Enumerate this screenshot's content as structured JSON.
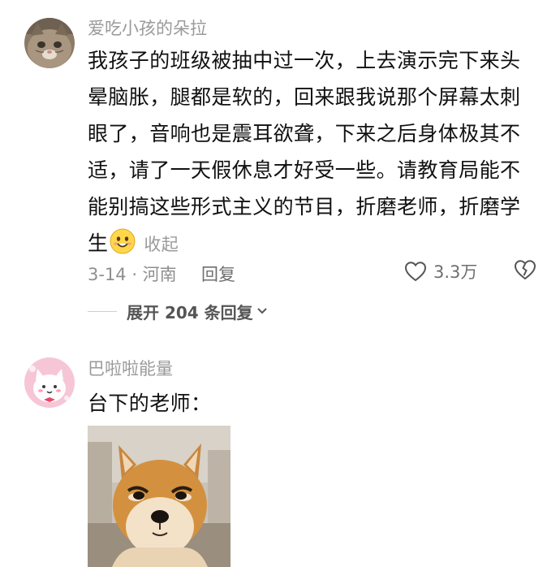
{
  "comments": [
    {
      "username": "爱吃小孩的朵拉",
      "avatar_icon": "cat-face-avatar",
      "text_lines": [
        "我孩子的班级被抽中过一次，上去演示完下来头",
        "晕脑胀，腿都是软的，回来跟我说那个屏幕太刺",
        "眼了，音响也是震耳欲聋，下来之后身体极其不",
        "适，请了一天假休息才好受一些。请教育局能不",
        "能别搞这些形式主义的节目，折磨老师，折磨学",
        "生"
      ],
      "emoji_icon": "smiley-emoji-icon",
      "collapse_label": "收起",
      "date_location": "3-14 · 河南",
      "reply_label": "回复",
      "like_count": "3.3万",
      "expand_replies_label": "展开 204 条回复"
    },
    {
      "username": "巴啦啦能量",
      "avatar_icon": "cartoon-cat-avatar",
      "text": "台下的老师：",
      "image_icon": "shiba-inu-photo"
    }
  ],
  "colors": {
    "username": "#9a9a9a",
    "meta": "#8f8f8f",
    "text": "#111111",
    "avatar2_background": "#f6c6d6"
  }
}
